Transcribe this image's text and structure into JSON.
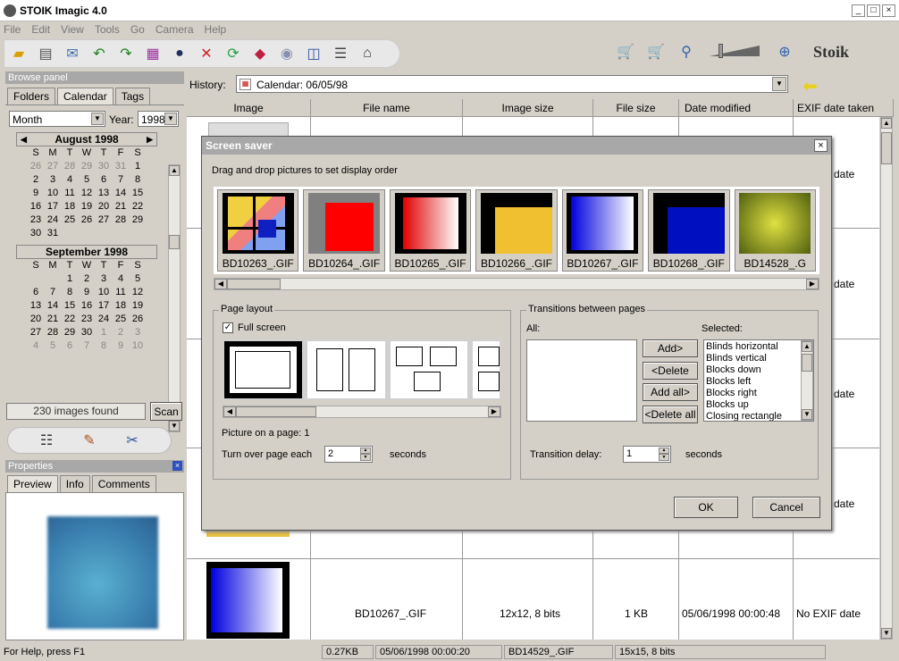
{
  "window": {
    "title": "STOIK Imagic 4.0",
    "min": "_",
    "max": "□",
    "close": "×"
  },
  "menu": [
    "File",
    "Edit",
    "View",
    "Tools",
    "Go",
    "Camera",
    "Help"
  ],
  "browse_panel": {
    "title": "Browse panel",
    "tabs": [
      "Folders",
      "Calendar",
      "Tags"
    ],
    "period": "Month",
    "year_label": "Year:",
    "year": "1998",
    "images_found": "230 images found",
    "scan": "Scan"
  },
  "calendar": {
    "weekdays": [
      "S",
      "M",
      "T",
      "W",
      "T",
      "F",
      "S"
    ],
    "months": [
      {
        "name": "August 1998",
        "days": [
          {
            "d": "26",
            "m": 1
          },
          {
            "d": "27",
            "m": 1
          },
          {
            "d": "28",
            "m": 1
          },
          {
            "d": "29",
            "m": 1
          },
          {
            "d": "30",
            "m": 1
          },
          {
            "d": "31",
            "m": 1
          },
          {
            "d": "1",
            "m": 0
          },
          {
            "d": "2",
            "m": 0
          },
          {
            "d": "3",
            "m": 0
          },
          {
            "d": "4",
            "m": 0
          },
          {
            "d": "5",
            "m": 0
          },
          {
            "d": "6",
            "m": 0
          },
          {
            "d": "7",
            "m": 0
          },
          {
            "d": "8",
            "m": 0
          },
          {
            "d": "9",
            "m": 0
          },
          {
            "d": "10",
            "m": 0
          },
          {
            "d": "11",
            "m": 0
          },
          {
            "d": "12",
            "m": 0
          },
          {
            "d": "13",
            "m": 0
          },
          {
            "d": "14",
            "m": 0
          },
          {
            "d": "15",
            "m": 0
          },
          {
            "d": "16",
            "m": 0
          },
          {
            "d": "17",
            "m": 0
          },
          {
            "d": "18",
            "m": 0
          },
          {
            "d": "19",
            "m": 0
          },
          {
            "d": "20",
            "m": 0
          },
          {
            "d": "21",
            "m": 0
          },
          {
            "d": "22",
            "m": 0
          },
          {
            "d": "23",
            "m": 0
          },
          {
            "d": "24",
            "m": 0
          },
          {
            "d": "25",
            "m": 0
          },
          {
            "d": "26",
            "m": 0
          },
          {
            "d": "27",
            "m": 0
          },
          {
            "d": "28",
            "m": 0
          },
          {
            "d": "29",
            "m": 0
          },
          {
            "d": "30",
            "m": 0
          },
          {
            "d": "31",
            "m": 0
          }
        ]
      },
      {
        "name": "September 1998",
        "days": [
          {
            "d": "",
            "m": 0
          },
          {
            "d": "",
            "m": 0
          },
          {
            "d": "1",
            "m": 0
          },
          {
            "d": "2",
            "m": 0
          },
          {
            "d": "3",
            "m": 0
          },
          {
            "d": "4",
            "m": 0
          },
          {
            "d": "5",
            "m": 0
          },
          {
            "d": "6",
            "m": 0
          },
          {
            "d": "7",
            "m": 0
          },
          {
            "d": "8",
            "m": 0
          },
          {
            "d": "9",
            "m": 0
          },
          {
            "d": "10",
            "m": 0
          },
          {
            "d": "11",
            "m": 0
          },
          {
            "d": "12",
            "m": 0
          },
          {
            "d": "13",
            "m": 0
          },
          {
            "d": "14",
            "m": 0
          },
          {
            "d": "15",
            "m": 0
          },
          {
            "d": "16",
            "m": 0
          },
          {
            "d": "17",
            "m": 0
          },
          {
            "d": "18",
            "m": 0
          },
          {
            "d": "19",
            "m": 0
          },
          {
            "d": "20",
            "m": 0
          },
          {
            "d": "21",
            "m": 0
          },
          {
            "d": "22",
            "m": 0
          },
          {
            "d": "23",
            "m": 0
          },
          {
            "d": "24",
            "m": 0
          },
          {
            "d": "25",
            "m": 0
          },
          {
            "d": "26",
            "m": 0
          },
          {
            "d": "27",
            "m": 0
          },
          {
            "d": "28",
            "m": 0
          },
          {
            "d": "29",
            "m": 0
          },
          {
            "d": "30",
            "m": 0
          },
          {
            "d": "1",
            "m": 1
          },
          {
            "d": "2",
            "m": 1
          },
          {
            "d": "3",
            "m": 1
          },
          {
            "d": "4",
            "m": 1
          },
          {
            "d": "5",
            "m": 1
          },
          {
            "d": "6",
            "m": 1
          },
          {
            "d": "7",
            "m": 1
          },
          {
            "d": "8",
            "m": 1
          },
          {
            "d": "9",
            "m": 1
          },
          {
            "d": "10",
            "m": 1
          }
        ]
      }
    ]
  },
  "properties": {
    "title": "Properties",
    "tabs": [
      "Preview",
      "Info",
      "Comments"
    ]
  },
  "history": {
    "label": "History:",
    "value": "Calendar: 06/05/98"
  },
  "columns": [
    "Image",
    "File name",
    "Image size",
    "File size",
    "Date modified",
    "EXIF date taken"
  ],
  "grid": {
    "partial_cells": [
      "date",
      "date",
      "date",
      "date"
    ],
    "last_row": {
      "file_name": "BD10267_.GIF",
      "image_size": "12x12, 8 bits",
      "file_size": "1 KB",
      "date_modified": "05/06/1998 00:00:48",
      "exif": "No EXIF date"
    }
  },
  "dialog": {
    "title": "Screen saver",
    "instructions": "Drag and drop pictures to set display order",
    "thumbs": [
      {
        "name": "BD10263_.GIF"
      },
      {
        "name": "BD10264_.GIF"
      },
      {
        "name": "BD10265_.GIF"
      },
      {
        "name": "BD10266_.GIF"
      },
      {
        "name": "BD10267_.GIF"
      },
      {
        "name": "BD10268_.GIF"
      },
      {
        "name": "BD14528_.G"
      }
    ],
    "page_layout": {
      "title": "Page layout",
      "full_screen": "Full screen",
      "picture_on_page": "Picture on a page: 1",
      "turn_over_label": "Turn over page each",
      "turn_over_value": "2",
      "seconds": "seconds"
    },
    "transitions": {
      "title": "Transitions between pages",
      "all_label": "All:",
      "selected_label": "Selected:",
      "add": "Add>",
      "delete": "<Delete",
      "add_all": "Add all>",
      "delete_all": "<Delete all",
      "selected_items": [
        "Blinds horizontal",
        "Blinds vertical",
        "Blocks down",
        "Blocks left",
        "Blocks right",
        "Blocks up",
        "Closing rectangle"
      ],
      "delay_label": "Transition delay:",
      "delay_value": "1",
      "seconds": "seconds"
    },
    "ok": "OK",
    "cancel": "Cancel"
  },
  "status": {
    "help": "For Help, press F1",
    "size": "0.27KB",
    "date": "05/06/1998 00:00:20",
    "file": "BD14529_.GIF",
    "dims": "15x15, 8 bits"
  },
  "colors": {
    "panel_header": "#a8a8a8",
    "bg": "#d4d0c8"
  }
}
